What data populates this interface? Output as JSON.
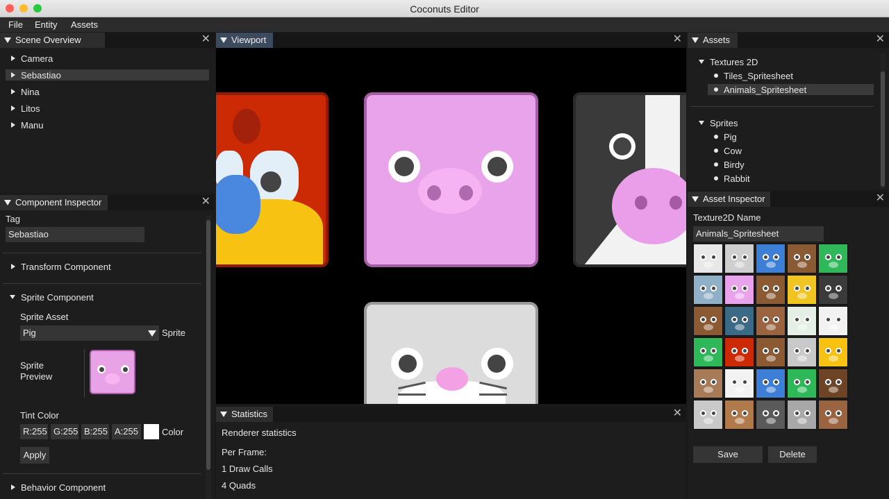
{
  "window": {
    "title": "Coconuts Editor"
  },
  "menu": [
    "File",
    "Entity",
    "Assets"
  ],
  "scene_overview": {
    "title": "Scene Overview",
    "items": [
      "Camera",
      "Sebastiao",
      "Nina",
      "Litos",
      "Manu"
    ],
    "selected": "Sebastiao"
  },
  "inspector": {
    "title": "Component Inspector",
    "tag_label": "Tag",
    "tag_value": "Sebastiao",
    "transform_label": "Transform Component",
    "sprite_label": "Sprite Component",
    "sprite_asset_label": "Sprite Asset",
    "sprite_asset_value": "Pig",
    "sprite_asset_suffix": "Sprite",
    "preview_label_1": "Sprite",
    "preview_label_2": "Preview",
    "tint_label": "Tint Color",
    "tint_r": "R:255",
    "tint_g": "G:255",
    "tint_b": "B:255",
    "tint_a": "A:255",
    "color_label": "Color",
    "apply_label": "Apply",
    "behavior_label": "Behavior Component"
  },
  "viewport": {
    "title": "Viewport"
  },
  "statistics": {
    "title": "Statistics",
    "heading": "Renderer statistics",
    "per_frame": "Per Frame:",
    "draw_calls": "1 Draw Calls",
    "quads": "4 Quads"
  },
  "assets": {
    "title": "Assets",
    "textures_label": "Textures 2D",
    "textures": [
      "Tiles_Spritesheet",
      "Animals_Spritesheet"
    ],
    "selected_texture": "Animals_Spritesheet",
    "sprites_label": "Sprites",
    "sprites": [
      "Pig",
      "Cow",
      "Birdy",
      "Rabbit"
    ]
  },
  "asset_inspector": {
    "title": "Asset Inspector",
    "name_label": "Texture2D Name",
    "name_value": "Animals_Spritesheet",
    "save_label": "Save",
    "delete_label": "Delete"
  },
  "colors": {
    "background": "#1d1d1d",
    "panel_header": "#171717",
    "active_tab": "#3c4a5e",
    "field": "#353535",
    "selection": "#3a3a3a"
  },
  "spritesheet_tiles": [
    [
      "zebra",
      "rhino-grey",
      "narwhal",
      "moose",
      "crocodile"
    ],
    [
      "walrus",
      "pig",
      "bear",
      "giraffe",
      "cow"
    ],
    [
      "walrus-brown",
      "penguin",
      "bear-brown",
      "frog",
      "chicken"
    ],
    [
      "gator",
      "parrot",
      "horse",
      "elephant",
      "chick"
    ],
    [
      "sloth",
      "panda",
      "whale",
      "duck",
      "buffalo"
    ],
    [
      "rhino",
      "owl",
      "gorilla",
      "koala",
      "monkey"
    ]
  ]
}
